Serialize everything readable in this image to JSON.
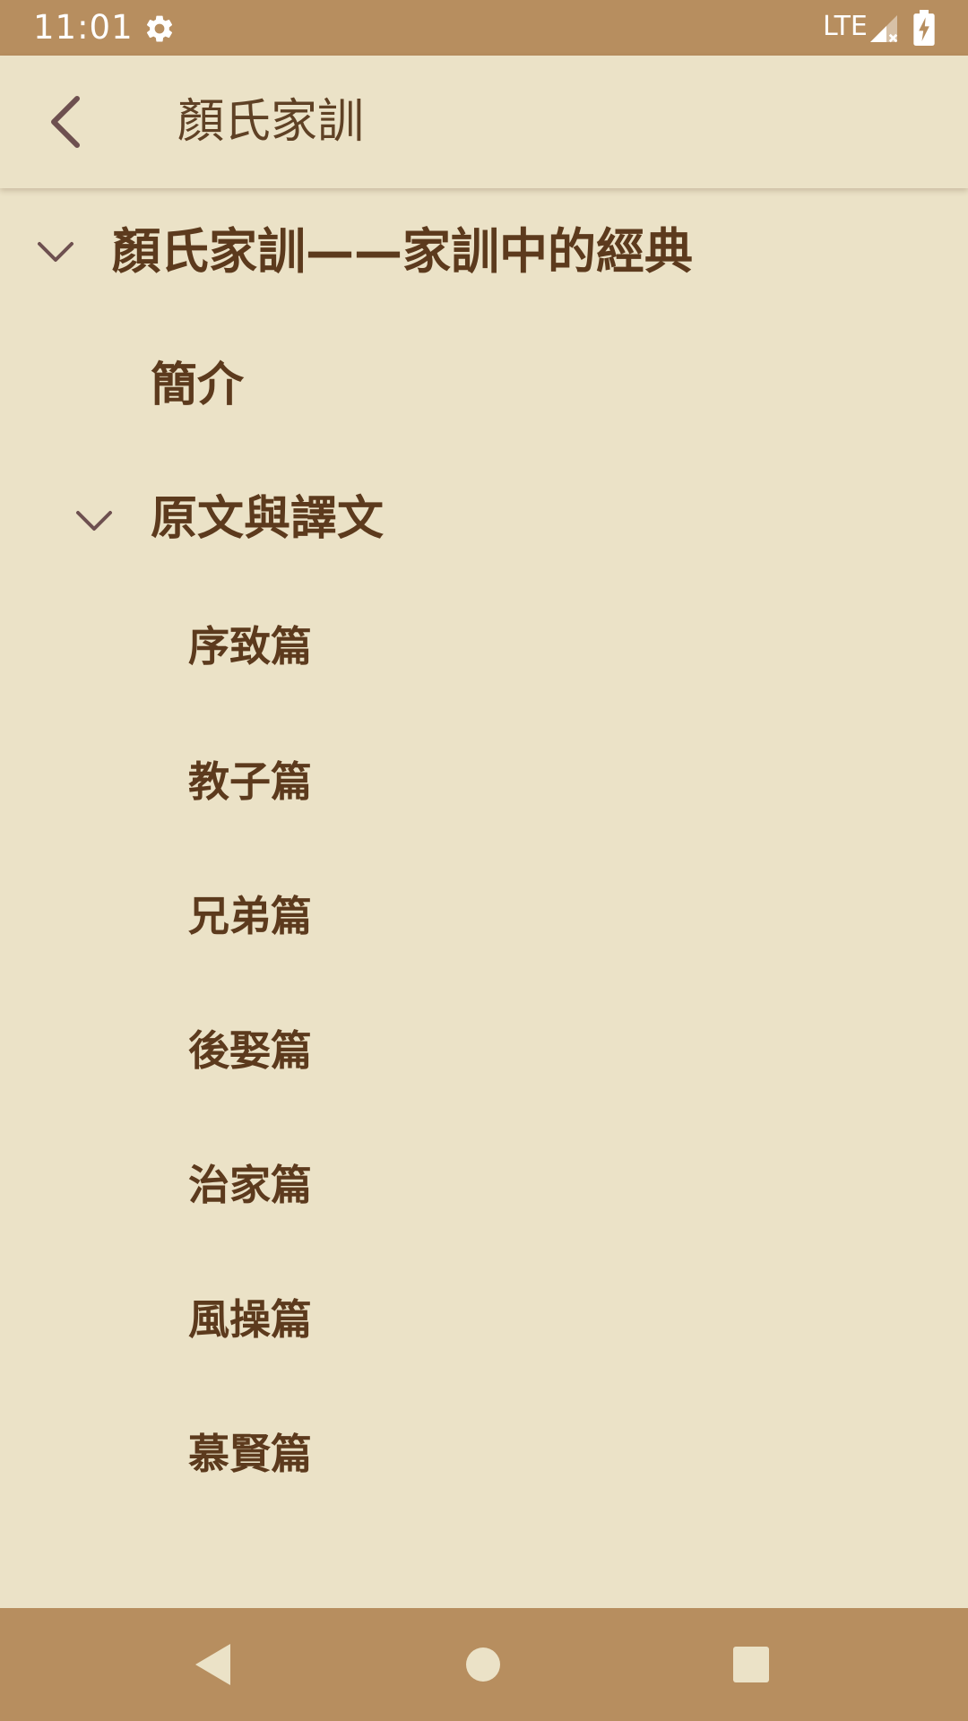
{
  "status_bar": {
    "time": "11:01",
    "network": "LTE",
    "icons": [
      "gear-icon",
      "signal-icon",
      "battery-charging-icon"
    ]
  },
  "app_bar": {
    "title": "顏氏家訓",
    "back_icon": "chevron-left-icon"
  },
  "tree": {
    "root": {
      "label": "顏氏家訓——家訓中的經典",
      "expanded": true
    },
    "intro": {
      "label": "簡介"
    },
    "section": {
      "label": "原文與譯文",
      "expanded": true
    },
    "chapters": [
      {
        "label": "序致篇"
      },
      {
        "label": "教子篇"
      },
      {
        "label": "兄弟篇"
      },
      {
        "label": "後娶篇"
      },
      {
        "label": "治家篇"
      },
      {
        "label": "風操篇"
      },
      {
        "label": "慕賢篇"
      }
    ]
  },
  "nav_bar": {
    "icons": [
      "back-triangle-icon",
      "home-circle-icon",
      "recents-square-icon"
    ]
  },
  "colors": {
    "status_bar": "#b78e5f",
    "background": "#ebe2c7",
    "text": "#5c3a1d",
    "chevron": "#6e5050"
  }
}
